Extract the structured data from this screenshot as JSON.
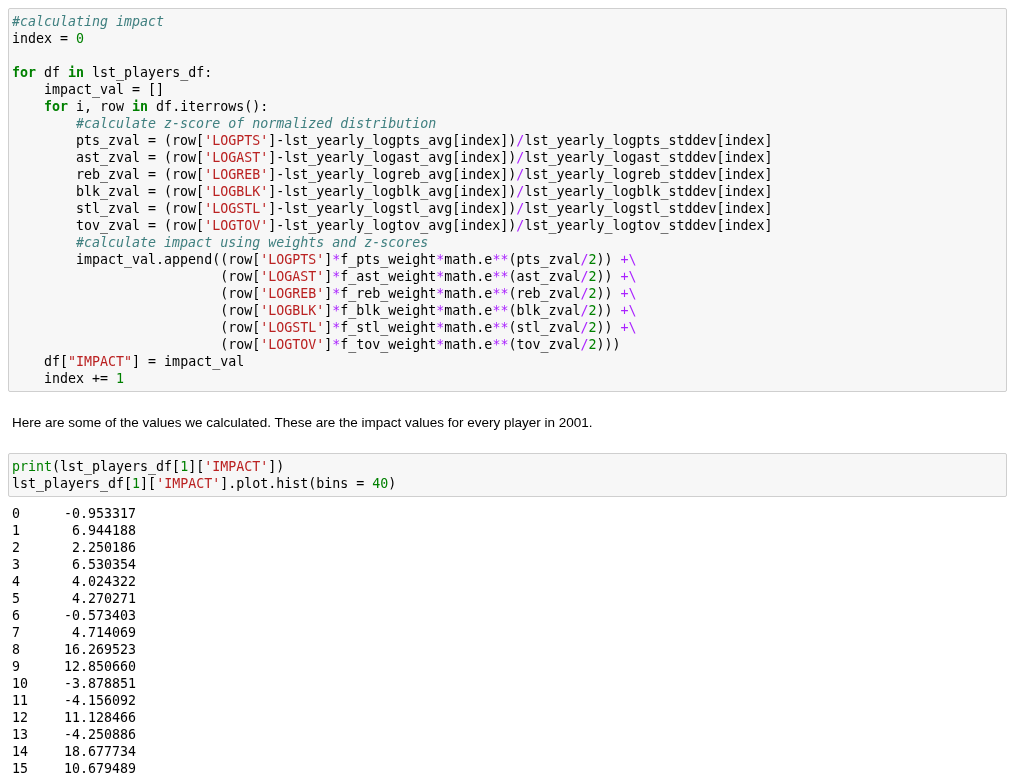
{
  "cells": [
    {
      "kind": "code",
      "lines": [
        {
          "tokens": [
            {
              "kind": "comment",
              "text": "#calculating impact"
            }
          ]
        },
        {
          "tokens": [
            {
              "kind": "plain",
              "text": "index = "
            },
            {
              "kind": "number",
              "text": "0"
            }
          ]
        },
        {
          "blank_before": true,
          "tokens": [
            {
              "kind": "keyword",
              "text": "for"
            },
            {
              "kind": "plain",
              "text": " df "
            },
            {
              "kind": "keyword",
              "text": "in"
            },
            {
              "kind": "plain",
              "text": " lst_players_df:"
            }
          ]
        },
        {
          "tokens": [
            {
              "kind": "plain",
              "text": "    impact_val = []"
            }
          ]
        },
        {
          "tokens": [
            {
              "kind": "keyword",
              "text": "    for"
            },
            {
              "kind": "plain",
              "text": " i, row "
            },
            {
              "kind": "keyword",
              "text": "in"
            },
            {
              "kind": "plain",
              "text": " df.iterrows():"
            }
          ]
        },
        {
          "tokens": [
            {
              "kind": "comment",
              "text": "        #calculate z-score of normalized distribution"
            }
          ]
        },
        {
          "tokens": [
            {
              "kind": "plain",
              "text": "        pts_zval = (row["
            },
            {
              "kind": "string",
              "text": "'LOGPTS'"
            },
            {
              "kind": "plain",
              "text": "]-lst_yearly_logpts_avg[index])"
            },
            {
              "kind": "operator",
              "text": "/"
            },
            {
              "kind": "plain",
              "text": "lst_yearly_logpts_stddev[index]"
            }
          ]
        },
        {
          "tokens": [
            {
              "kind": "plain",
              "text": "        ast_zval = (row["
            },
            {
              "kind": "string",
              "text": "'LOGAST'"
            },
            {
              "kind": "plain",
              "text": "]-lst_yearly_logast_avg[index])"
            },
            {
              "kind": "operator",
              "text": "/"
            },
            {
              "kind": "plain",
              "text": "lst_yearly_logast_stddev[index]"
            }
          ]
        },
        {
          "tokens": [
            {
              "kind": "plain",
              "text": "        reb_zval = (row["
            },
            {
              "kind": "string",
              "text": "'LOGREB'"
            },
            {
              "kind": "plain",
              "text": "]-lst_yearly_logreb_avg[index])"
            },
            {
              "kind": "operator",
              "text": "/"
            },
            {
              "kind": "plain",
              "text": "lst_yearly_logreb_stddev[index]"
            }
          ]
        },
        {
          "tokens": [
            {
              "kind": "plain",
              "text": "        blk_zval = (row["
            },
            {
              "kind": "string",
              "text": "'LOGBLK'"
            },
            {
              "kind": "plain",
              "text": "]-lst_yearly_logblk_avg[index])"
            },
            {
              "kind": "operator",
              "text": "/"
            },
            {
              "kind": "plain",
              "text": "lst_yearly_logblk_stddev[index]"
            }
          ]
        },
        {
          "tokens": [
            {
              "kind": "plain",
              "text": "        stl_zval = (row["
            },
            {
              "kind": "string",
              "text": "'LOGSTL'"
            },
            {
              "kind": "plain",
              "text": "]-lst_yearly_logstl_avg[index])"
            },
            {
              "kind": "operator",
              "text": "/"
            },
            {
              "kind": "plain",
              "text": "lst_yearly_logstl_stddev[index]"
            }
          ]
        },
        {
          "tokens": [
            {
              "kind": "plain",
              "text": "        tov_zval = (row["
            },
            {
              "kind": "string",
              "text": "'LOGTOV'"
            },
            {
              "kind": "plain",
              "text": "]-lst_yearly_logtov_avg[index])"
            },
            {
              "kind": "operator",
              "text": "/"
            },
            {
              "kind": "plain",
              "text": "lst_yearly_logtov_stddev[index]"
            }
          ]
        },
        {
          "tokens": [
            {
              "kind": "comment",
              "text": "        #calculate impact using weights and z-scores"
            }
          ]
        },
        {
          "tokens": [
            {
              "kind": "plain",
              "text": "        impact_val.append((row["
            },
            {
              "kind": "string",
              "text": "'LOGPTS'"
            },
            {
              "kind": "plain",
              "text": "]"
            },
            {
              "kind": "operator",
              "text": "*"
            },
            {
              "kind": "plain",
              "text": "f_pts_weight"
            },
            {
              "kind": "operator",
              "text": "*"
            },
            {
              "kind": "plain",
              "text": "math.e"
            },
            {
              "kind": "operator",
              "text": "**"
            },
            {
              "kind": "plain",
              "text": "(pts_zval"
            },
            {
              "kind": "operator",
              "text": "/"
            },
            {
              "kind": "number",
              "text": "2"
            },
            {
              "kind": "plain",
              "text": ")) "
            },
            {
              "kind": "operator",
              "text": "+\\"
            }
          ]
        },
        {
          "tokens": [
            {
              "kind": "plain",
              "text": "                          (row["
            },
            {
              "kind": "string",
              "text": "'LOGAST'"
            },
            {
              "kind": "plain",
              "text": "]"
            },
            {
              "kind": "operator",
              "text": "*"
            },
            {
              "kind": "plain",
              "text": "f_ast_weight"
            },
            {
              "kind": "operator",
              "text": "*"
            },
            {
              "kind": "plain",
              "text": "math.e"
            },
            {
              "kind": "operator",
              "text": "**"
            },
            {
              "kind": "plain",
              "text": "(ast_zval"
            },
            {
              "kind": "operator",
              "text": "/"
            },
            {
              "kind": "number",
              "text": "2"
            },
            {
              "kind": "plain",
              "text": ")) "
            },
            {
              "kind": "operator",
              "text": "+\\"
            }
          ]
        },
        {
          "tokens": [
            {
              "kind": "plain",
              "text": "                          (row["
            },
            {
              "kind": "string",
              "text": "'LOGREB'"
            },
            {
              "kind": "plain",
              "text": "]"
            },
            {
              "kind": "operator",
              "text": "*"
            },
            {
              "kind": "plain",
              "text": "f_reb_weight"
            },
            {
              "kind": "operator",
              "text": "*"
            },
            {
              "kind": "plain",
              "text": "math.e"
            },
            {
              "kind": "operator",
              "text": "**"
            },
            {
              "kind": "plain",
              "text": "(reb_zval"
            },
            {
              "kind": "operator",
              "text": "/"
            },
            {
              "kind": "number",
              "text": "2"
            },
            {
              "kind": "plain",
              "text": ")) "
            },
            {
              "kind": "operator",
              "text": "+\\"
            }
          ]
        },
        {
          "tokens": [
            {
              "kind": "plain",
              "text": "                          (row["
            },
            {
              "kind": "string",
              "text": "'LOGBLK'"
            },
            {
              "kind": "plain",
              "text": "]"
            },
            {
              "kind": "operator",
              "text": "*"
            },
            {
              "kind": "plain",
              "text": "f_blk_weight"
            },
            {
              "kind": "operator",
              "text": "*"
            },
            {
              "kind": "plain",
              "text": "math.e"
            },
            {
              "kind": "operator",
              "text": "**"
            },
            {
              "kind": "plain",
              "text": "(blk_zval"
            },
            {
              "kind": "operator",
              "text": "/"
            },
            {
              "kind": "number",
              "text": "2"
            },
            {
              "kind": "plain",
              "text": ")) "
            },
            {
              "kind": "operator",
              "text": "+\\"
            }
          ]
        },
        {
          "tokens": [
            {
              "kind": "plain",
              "text": "                          (row["
            },
            {
              "kind": "string",
              "text": "'LOGSTL'"
            },
            {
              "kind": "plain",
              "text": "]"
            },
            {
              "kind": "operator",
              "text": "*"
            },
            {
              "kind": "plain",
              "text": "f_stl_weight"
            },
            {
              "kind": "operator",
              "text": "*"
            },
            {
              "kind": "plain",
              "text": "math.e"
            },
            {
              "kind": "operator",
              "text": "**"
            },
            {
              "kind": "plain",
              "text": "(stl_zval"
            },
            {
              "kind": "operator",
              "text": "/"
            },
            {
              "kind": "number",
              "text": "2"
            },
            {
              "kind": "plain",
              "text": ")) "
            },
            {
              "kind": "operator",
              "text": "+\\"
            }
          ]
        },
        {
          "tokens": [
            {
              "kind": "plain",
              "text": "                          (row["
            },
            {
              "kind": "string",
              "text": "'LOGTOV'"
            },
            {
              "kind": "plain",
              "text": "]"
            },
            {
              "kind": "operator",
              "text": "*"
            },
            {
              "kind": "plain",
              "text": "f_tov_weight"
            },
            {
              "kind": "operator",
              "text": "*"
            },
            {
              "kind": "plain",
              "text": "math.e"
            },
            {
              "kind": "operator",
              "text": "**"
            },
            {
              "kind": "plain",
              "text": "(tov_zval"
            },
            {
              "kind": "operator",
              "text": "/"
            },
            {
              "kind": "number",
              "text": "2"
            },
            {
              "kind": "plain",
              "text": ")))"
            }
          ]
        },
        {
          "tokens": [
            {
              "kind": "plain",
              "text": "    df["
            },
            {
              "kind": "string",
              "text": "\"IMPACT\""
            },
            {
              "kind": "plain",
              "text": "] = impact_val"
            }
          ]
        },
        {
          "tokens": [
            {
              "kind": "plain",
              "text": "    index += "
            },
            {
              "kind": "number",
              "text": "1"
            }
          ]
        }
      ]
    },
    {
      "kind": "markdown",
      "text": "Here are some of the values we calculated. These are the impact values for every player in 2001."
    },
    {
      "kind": "code",
      "lines": [
        {
          "tokens": [
            {
              "kind": "builtin",
              "text": "print"
            },
            {
              "kind": "plain",
              "text": "(lst_players_df["
            },
            {
              "kind": "number",
              "text": "1"
            },
            {
              "kind": "plain",
              "text": "]["
            },
            {
              "kind": "string",
              "text": "'IMPACT'"
            },
            {
              "kind": "plain",
              "text": "])"
            }
          ]
        },
        {
          "tokens": [
            {
              "kind": "plain",
              "text": "lst_players_df["
            },
            {
              "kind": "number",
              "text": "1"
            },
            {
              "kind": "plain",
              "text": "]["
            },
            {
              "kind": "string",
              "text": "'IMPACT'"
            },
            {
              "kind": "plain",
              "text": "].plot.hist(bins = "
            },
            {
              "kind": "number",
              "text": "40"
            },
            {
              "kind": "plain",
              "text": ")"
            }
          ]
        }
      ]
    },
    {
      "kind": "output",
      "rows": [
        {
          "index": "0",
          "value": "-0.953317"
        },
        {
          "index": "1",
          "value": "6.944188"
        },
        {
          "index": "2",
          "value": "2.250186"
        },
        {
          "index": "3",
          "value": "6.530354"
        },
        {
          "index": "4",
          "value": "4.024322"
        },
        {
          "index": "5",
          "value": "4.270271"
        },
        {
          "index": "6",
          "value": "-0.573403"
        },
        {
          "index": "7",
          "value": "4.714069"
        },
        {
          "index": "8",
          "value": "16.269523"
        },
        {
          "index": "9",
          "value": "12.850660"
        },
        {
          "index": "10",
          "value": "-3.878851"
        },
        {
          "index": "11",
          "value": "-4.156092"
        },
        {
          "index": "12",
          "value": "11.128466"
        },
        {
          "index": "13",
          "value": "-4.250886"
        },
        {
          "index": "14",
          "value": "18.677734"
        },
        {
          "index": "15",
          "value": "10.679489"
        }
      ]
    }
  ]
}
